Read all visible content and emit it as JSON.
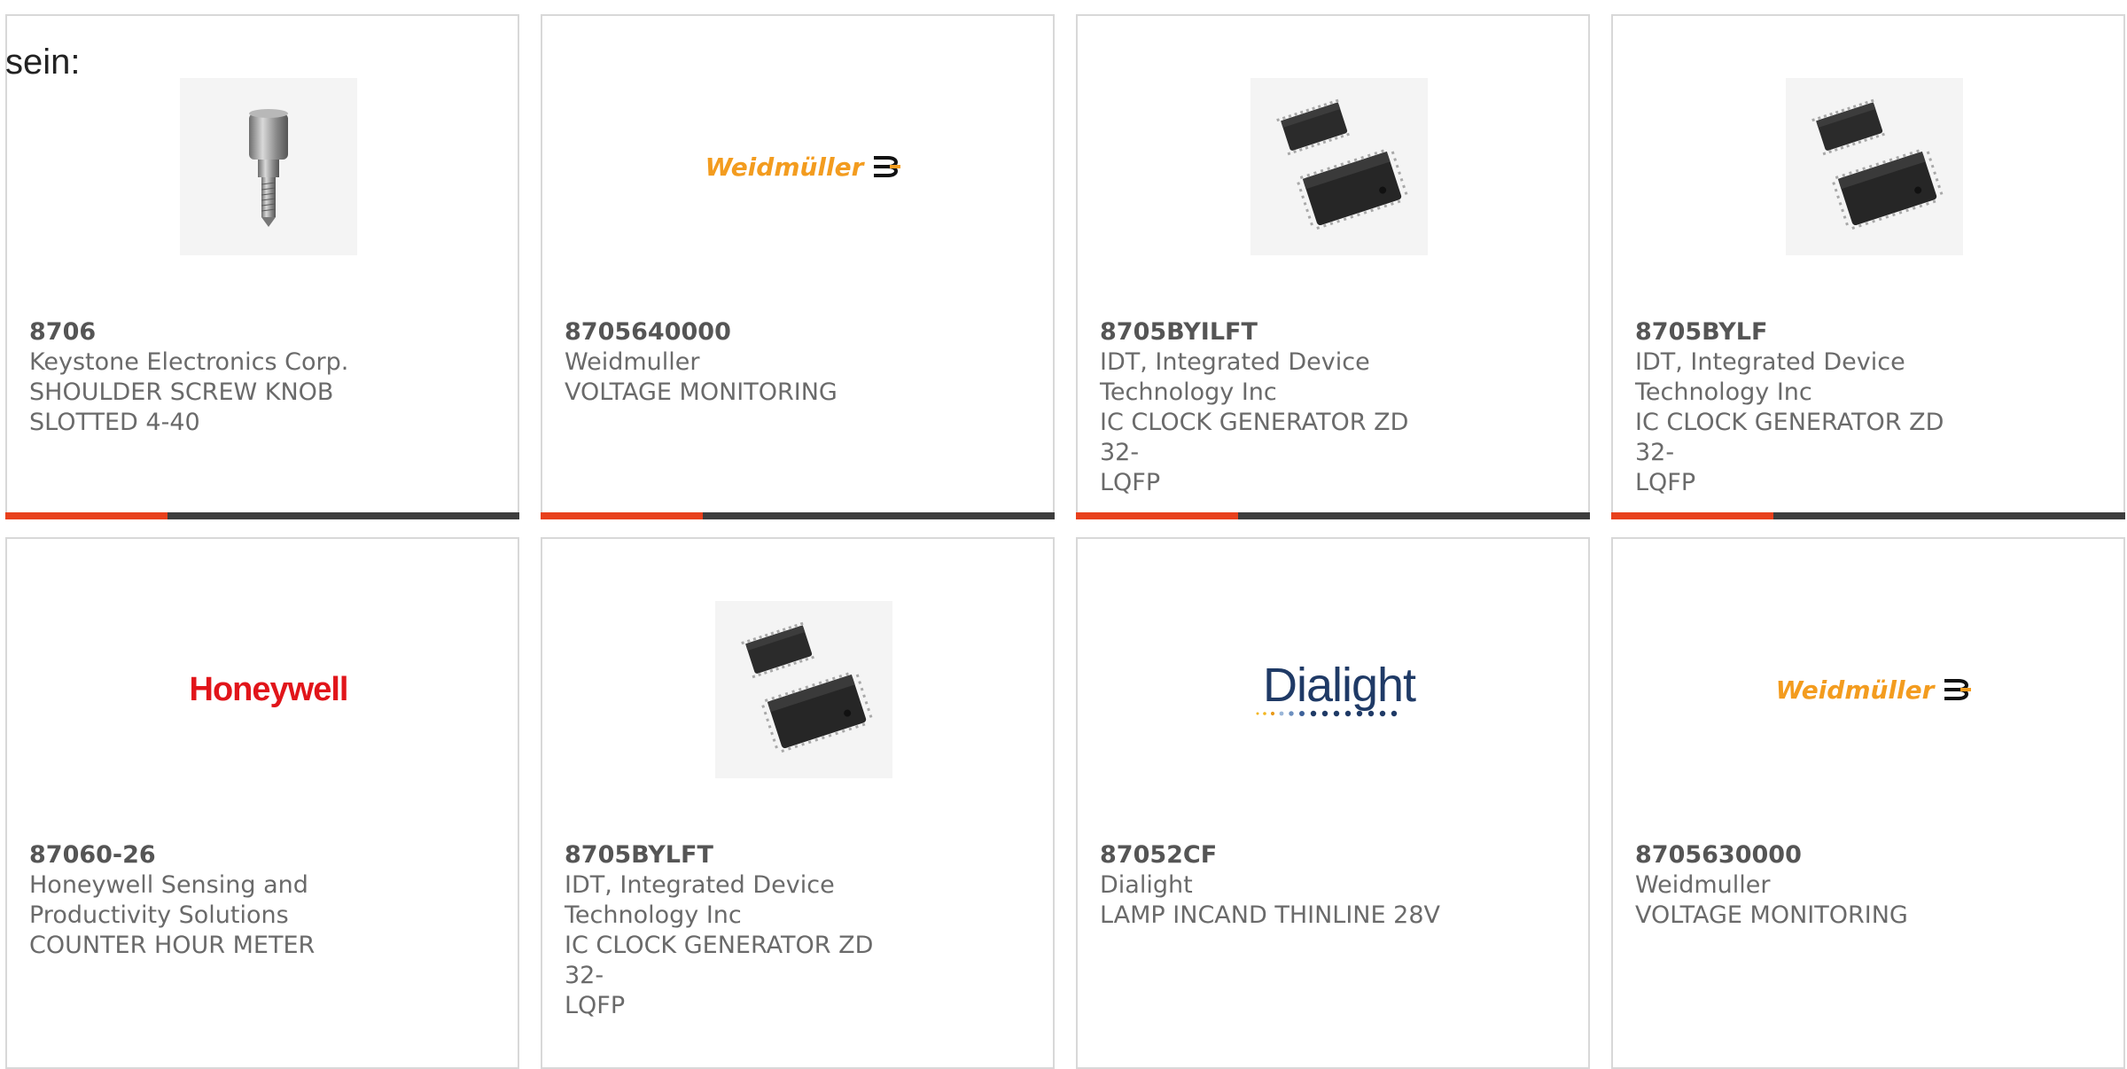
{
  "lead_text": "sein:",
  "products": [
    {
      "part_number": "8706",
      "manufacturer": "Keystone Electronics Corp.",
      "desc_lines": [
        "SHOULDER SCREW KNOB",
        "SLOTTED 4-40"
      ],
      "image": "screw-knob-image"
    },
    {
      "part_number": "8705640000",
      "manufacturer": "Weidmuller",
      "desc_lines": [
        "VOLTAGE MONITORING"
      ],
      "image": "weidmuller-logo",
      "logo_text": "Weidmüller"
    },
    {
      "part_number": "8705BYILFT",
      "manufacturer_lines": [
        "IDT, Integrated Device",
        "Technology Inc"
      ],
      "desc_lines": [
        "IC CLOCK GENERATOR ZD 32-",
        "LQFP"
      ],
      "image": "lqfp-chip-image"
    },
    {
      "part_number": "8705BYLF",
      "manufacturer_lines": [
        "IDT, Integrated Device",
        "Technology Inc"
      ],
      "desc_lines": [
        "IC CLOCK GENERATOR ZD 32-",
        "LQFP"
      ],
      "image": "lqfp-chip-image"
    },
    {
      "part_number": "87060-26",
      "manufacturer_lines": [
        "Honeywell Sensing and",
        "Productivity Solutions"
      ],
      "desc_lines": [
        "COUNTER HOUR METER"
      ],
      "image": "honeywell-logo",
      "logo_text": "Honeywell"
    },
    {
      "part_number": "8705BYLFT",
      "manufacturer_lines": [
        "IDT, Integrated Device",
        "Technology Inc"
      ],
      "desc_lines": [
        "IC CLOCK GENERATOR ZD 32-",
        "LQFP"
      ],
      "image": "lqfp-chip-image"
    },
    {
      "part_number": "87052CF",
      "manufacturer": "Dialight",
      "desc_lines": [
        "LAMP INCAND THINLINE 28V"
      ],
      "image": "dialight-logo",
      "logo_text": "Dialight"
    },
    {
      "part_number": "8705630000",
      "manufacturer": "Weidmuller",
      "desc_lines": [
        "VOLTAGE MONITORING"
      ],
      "image": "weidmuller-logo",
      "logo_text": "Weidmüller"
    }
  ],
  "colors": {
    "accent": "#e8401c",
    "bar": "#3d3d3d",
    "border": "#d8d8d8",
    "text": "#6a6a6a",
    "weidmuller": "#f39c1f",
    "honeywell": "#e1151a",
    "dialight": "#1f3a66"
  }
}
